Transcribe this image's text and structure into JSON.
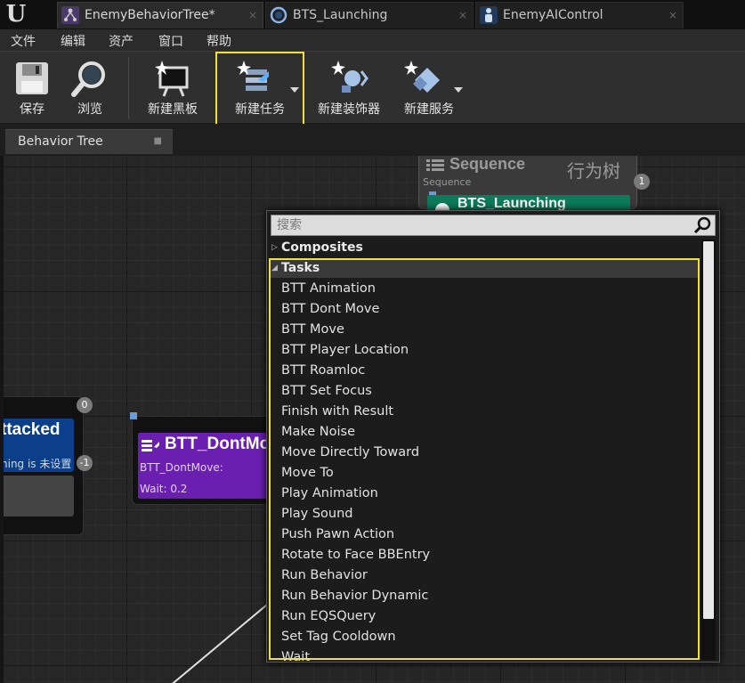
{
  "window": {
    "tabs": [
      {
        "label": "EnemyBehaviorTree*",
        "icon": "behavior-tree-icon",
        "active": true
      },
      {
        "label": "BTS_Launching",
        "icon": "blueprint-circle-icon",
        "active": false
      },
      {
        "label": "EnemyAIControl",
        "icon": "ai-controller-icon",
        "active": false
      }
    ],
    "close_glyph": "×"
  },
  "menu": [
    "文件",
    "编辑",
    "资产",
    "窗口",
    "帮助"
  ],
  "toolbar": {
    "save_label": "保存",
    "browse_label": "浏览",
    "new_blackboard_label": "新建黑板",
    "new_task_label": "新建任务",
    "new_decorator_label": "新建装饰器",
    "new_service_label": "新建服务"
  },
  "editor_tab": {
    "label": "Behavior Tree"
  },
  "graph": {
    "watermark": "行为树",
    "sequence_node": {
      "title": "Sequence",
      "subtitle": "Sequence",
      "badge": "1",
      "child_title": "BTS_Launching"
    },
    "left_node": {
      "title": "ttacked",
      "desc": "hing is 未设置",
      "badge_top": "0",
      "badge_side": "-1"
    },
    "task_node": {
      "title": "BTT_DontMo",
      "desc": "BTT_DontMove:",
      "wait": "Wait: 0.2"
    }
  },
  "context_menu": {
    "search_placeholder": "搜索",
    "composites_label": "Composites",
    "tasks_label": "Tasks",
    "tasks": [
      "BTT Animation",
      "BTT Dont Move",
      "BTT Move",
      "BTT Player Location",
      "BTT Roamloc",
      "BTT Set Focus",
      "Finish with Result",
      "Make Noise",
      "Move Directly Toward",
      "Move To",
      "Play Animation",
      "Play Sound",
      "Push Pawn Action",
      "Rotate to Face BBEntry",
      "Run Behavior",
      "Run Behavior Dynamic",
      "Run EQSQuery",
      "Set Tag Cooldown",
      "Wait"
    ]
  },
  "colors": {
    "highlight": "#f0e040",
    "task_node": "#6a1fb0",
    "sequence_child": "#0d7a5a",
    "left_node": "#0b3f8a"
  }
}
